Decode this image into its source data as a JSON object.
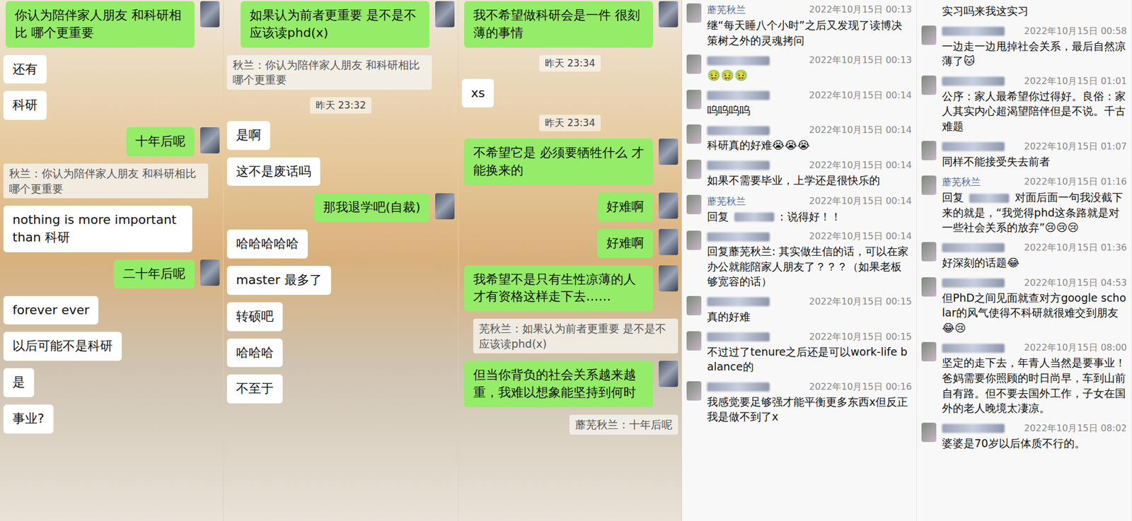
{
  "chat_panels": [
    {
      "messages": [
        {
          "kind": "bubble",
          "side": "me",
          "text": "你认为陪伴家人朋友 和科研相比 哪个更重要"
        },
        {
          "kind": "bubble",
          "side": "other",
          "text": "还有"
        },
        {
          "kind": "bubble",
          "side": "other",
          "text": "科研"
        },
        {
          "kind": "bubble",
          "side": "me",
          "text": "十年后呢"
        },
        {
          "kind": "quote",
          "side": "other",
          "text": "秋兰：你认为陪伴家人朋友 和科研相比 哪个更重要"
        },
        {
          "kind": "bubble",
          "side": "other",
          "text": "nothing is more important than 科研"
        },
        {
          "kind": "bubble",
          "side": "me",
          "text": "二十年后呢"
        },
        {
          "kind": "bubble",
          "side": "other",
          "text": "forever ever"
        },
        {
          "kind": "bubble",
          "side": "other",
          "text": "以后可能不是科研"
        },
        {
          "kind": "bubble",
          "side": "other",
          "text": "是"
        },
        {
          "kind": "bubble",
          "side": "other",
          "text": "事业?"
        }
      ]
    },
    {
      "messages": [
        {
          "kind": "bubble",
          "side": "me",
          "text": "如果认为前者更重要 是不是不应该读phd(x)"
        },
        {
          "kind": "quote",
          "side": "other",
          "text": "秋兰：你认为陪伴家人朋友 和科研相比 哪个更重要"
        },
        {
          "kind": "time",
          "side": "none",
          "text": "昨天 23:32"
        },
        {
          "kind": "bubble",
          "side": "other",
          "text": "是啊"
        },
        {
          "kind": "bubble",
          "side": "other",
          "text": "这不是废话吗"
        },
        {
          "kind": "bubble",
          "side": "me",
          "text": "那我退学吧(自裁)"
        },
        {
          "kind": "bubble",
          "side": "other",
          "text": "哈哈哈哈哈"
        },
        {
          "kind": "bubble",
          "side": "other",
          "text": "master 最多了"
        },
        {
          "kind": "bubble",
          "side": "other",
          "text": "转硕吧"
        },
        {
          "kind": "bubble",
          "side": "other",
          "text": "哈哈哈"
        },
        {
          "kind": "bubble",
          "side": "other",
          "text": "不至于"
        }
      ]
    },
    {
      "messages": [
        {
          "kind": "bubble",
          "side": "me",
          "text": "我不希望做科研会是一件 很刻薄的事情"
        },
        {
          "kind": "time",
          "side": "none",
          "text": "昨天 23:34"
        },
        {
          "kind": "bubble",
          "side": "other",
          "text": "xs"
        },
        {
          "kind": "time",
          "side": "none",
          "text": "昨天 23:34"
        },
        {
          "kind": "bubble",
          "side": "me",
          "text": "不希望它是 必须要牺牲什么 才能换来的"
        },
        {
          "kind": "bubble",
          "side": "me",
          "text": "好难啊"
        },
        {
          "kind": "bubble",
          "side": "me",
          "text": "好难啊"
        },
        {
          "kind": "bubble",
          "side": "me",
          "text": "我希望不是只有生性凉薄的人才有资格这样走下去……"
        },
        {
          "kind": "quote",
          "side": "me",
          "text": "芜秋兰：如果认为前者更重要 是不是不应该读phd(x)"
        },
        {
          "kind": "bubble",
          "side": "me",
          "text": "但当你背负的社会关系越来越重，我难以想象能坚持到何时"
        },
        {
          "kind": "quote",
          "side": "me",
          "text": "蘼芜秋兰：十年后呢"
        }
      ]
    }
  ],
  "comment_columns": [
    {
      "comments": [
        {
          "name": "蘼芜秋兰",
          "time": "2022年10月15日 00:13",
          "prefix": "",
          "reply_hidden": false,
          "text": "继“每天睡八个小时”之后又发现了读博决策树之外的灵魂拷问"
        },
        {
          "name": null,
          "time": "2022年10月15日 00:13",
          "prefix": "",
          "reply_hidden": false,
          "text": "🤢🤢🤢"
        },
        {
          "name": null,
          "time": "2022年10月15日 00:14",
          "prefix": "",
          "reply_hidden": false,
          "text": "呜呜呜呜"
        },
        {
          "name": null,
          "time": "2022年10月15日 00:14",
          "prefix": "",
          "reply_hidden": false,
          "text": "科研真的好难😭😭😭"
        },
        {
          "name": null,
          "time": "2022年10月15日 00:14",
          "prefix": "",
          "reply_hidden": false,
          "text": "如果不需要毕业，上学还是很快乐的"
        },
        {
          "name": "蘼芜秋兰",
          "time": "2022年10月15日 00:14",
          "prefix": "回复",
          "reply_hidden": true,
          "text": ": 说得好！！"
        },
        {
          "name": null,
          "time": "2022年10月15日 00:14",
          "prefix": "",
          "reply_hidden": false,
          "text": "回复蘼芜秋兰: 其实做生信的话，可以在家办公就能陪家人朋友了？？？（如果老板够宽容的话）"
        },
        {
          "name": null,
          "time": "2022年10月15日 00:15",
          "prefix": "",
          "reply_hidden": false,
          "text": "真的好难"
        },
        {
          "name": null,
          "time": "2022年10月15日 00:15",
          "prefix": "",
          "reply_hidden": false,
          "text": "不过过了tenure之后还是可以work-life balance的"
        },
        {
          "name": null,
          "time": "2022年10月15日 00:16",
          "prefix": "",
          "reply_hidden": false,
          "text": "我感觉要足够强才能平衡更多东西x但反正我是做不到了x"
        }
      ]
    },
    {
      "comments": [
        {
          "name": null,
          "time": null,
          "prefix": "",
          "reply_hidden": false,
          "text": "实习吗来我这实习"
        },
        {
          "name": null,
          "time": "2022年10月15日 00:58",
          "prefix": "",
          "reply_hidden": false,
          "text": "一边走一边甩掉社会关系，最后自然凉薄了🐱"
        },
        {
          "name": null,
          "time": "2022年10月15日 01:01",
          "prefix": "",
          "reply_hidden": false,
          "text": "公序：家人最希望你过得好。良俗：家人其实内心超渴望陪伴但是不说。千古难题"
        },
        {
          "name": null,
          "time": "2022年10月15日 01:07",
          "prefix": "",
          "reply_hidden": false,
          "text": "同样不能接受失去前者"
        },
        {
          "name": "蘼芜秋兰",
          "time": "2022年10月15日 01:16",
          "prefix": "回复",
          "reply_hidden": true,
          "text": "对面后面一句我没截下来的就是，“我觉得phd这条路就是对一些社会关系的放弃”😢😢😢"
        },
        {
          "name": null,
          "time": "2022年10月15日 01:36",
          "prefix": "",
          "reply_hidden": false,
          "text": "好深刻的话题😂"
        },
        {
          "name": null,
          "time": "2022年10月15日 04:53",
          "prefix": "",
          "reply_hidden": false,
          "text": "但PhD之间见面就查对方google scholar的风气使得不科研就很难交到朋友😂😢"
        },
        {
          "name": null,
          "time": "2022年10月15日 08:00",
          "prefix": "",
          "reply_hidden": false,
          "text": "坚定的走下去，年青人当然是要事业！爸妈需要你照顾的时日尚早，车到山前自有路。但不要去国外工作，子女在国外的老人晚境太凄凉。"
        },
        {
          "name": null,
          "time": "2022年10月15日 08:02",
          "prefix": "",
          "reply_hidden": false,
          "text": "婆婆是70岁以后体质不行的。"
        }
      ]
    }
  ]
}
